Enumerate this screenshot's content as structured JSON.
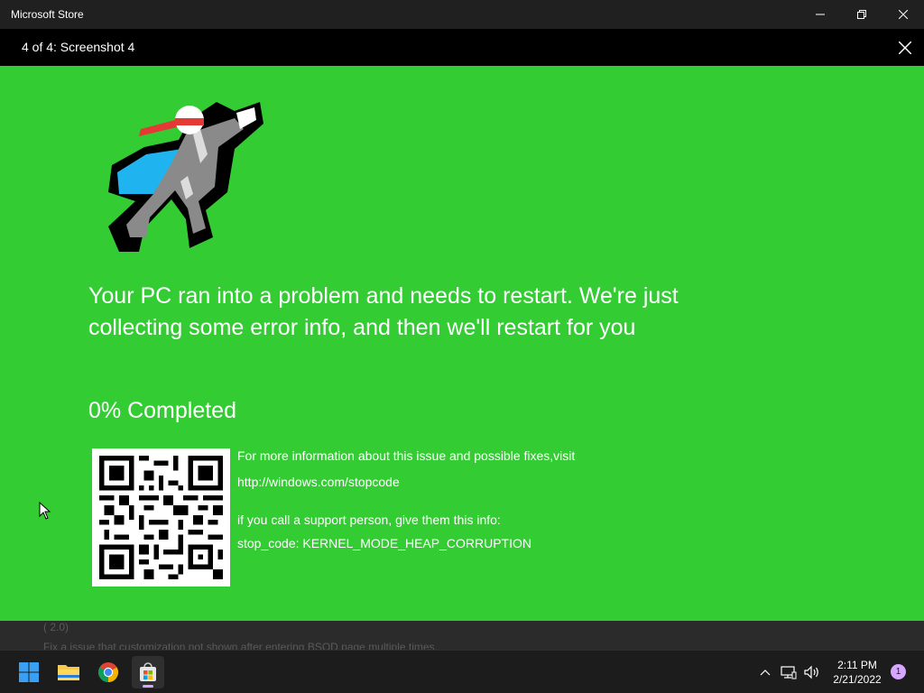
{
  "window": {
    "title": "Microsoft Store"
  },
  "viewer": {
    "title": "4 of 4: Screenshot 4"
  },
  "screenshot": {
    "message": "Your PC ran into a problem and needs to restart. We're just collecting some error info, and then we'll restart for you",
    "progress": "0% Completed",
    "info_line_1": "For more information about this issue and possible fixes,visit",
    "info_line_2": "http://windows.com/stopcode",
    "info_line_3": "if you call a support person, give them this info:",
    "info_line_4": "stop_code: KERNEL_MODE_HEAP_CORRUPTION",
    "background_color": "#33cc33"
  },
  "underlying": {
    "line_1": "( 2.0)",
    "line_2": "Fix a issue that customization not shown after entering BSOD page multiple times."
  },
  "taskbar": {
    "apps": [
      "windows-start-icon",
      "file-explorer-icon",
      "chrome-icon",
      "microsoft-store-icon"
    ],
    "time": "2:11 PM",
    "date": "2/21/2022",
    "notification_count": "1",
    "accent_color": "#d7a6ff"
  }
}
